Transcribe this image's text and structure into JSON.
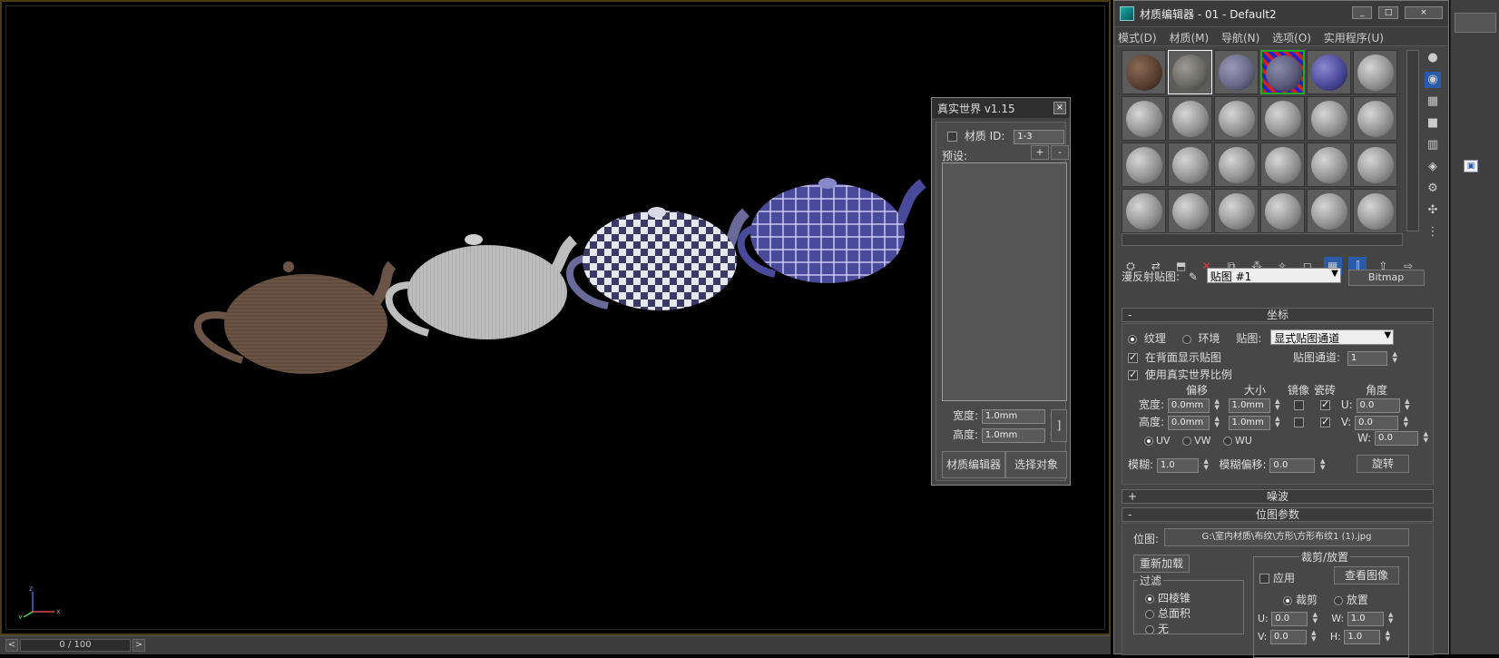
{
  "viewport": {
    "timeline": {
      "frame": "0 / 100",
      "prev": "<",
      "next": ">"
    },
    "axis": {
      "x": "x",
      "y": "y",
      "z": "z"
    }
  },
  "rw_panel": {
    "title": "真实世界 v1.15",
    "close": "×",
    "material_id_label": "材质 ID:",
    "material_id_value": "1-3",
    "preset_label": "预设:",
    "add": "+",
    "remove": "-",
    "width_label": "宽度:",
    "width_value": "1.0mm",
    "height_label": "高度:",
    "height_value": "1.0mm",
    "bracket": "]",
    "btn_editor": "材质编辑器",
    "btn_select": "选择对象"
  },
  "material_editor": {
    "title": "材质编辑器 - 01 - Default2",
    "window_buttons": [
      "_",
      "□",
      "×"
    ],
    "menu": [
      "模式(D)",
      "材质(M)",
      "导航(N)",
      "选项(O)",
      "实用程序(U)"
    ],
    "diffuse_label": "漫反射贴图:",
    "map_name": "贴图 #1",
    "map_type": "Bitmap",
    "coords": {
      "header": "坐标",
      "texture": "纹理",
      "environ": "环境",
      "mapping_label": "贴图:",
      "mapping_value": "显式贴图通道",
      "show_back": "在背面显示贴图",
      "real_world": "使用真实世界比例",
      "channel_label": "贴图通道:",
      "channel_value": "1",
      "col_offset": "偏移",
      "col_size": "大小",
      "col_mirror": "镜像",
      "col_tile": "瓷砖",
      "col_angle": "角度",
      "width_label": "宽度:",
      "height_label": "高度:",
      "offset_w": "0.0mm",
      "offset_h": "0.0mm",
      "size_w": "1.0mm",
      "size_h": "1.0mm",
      "u_label": "U:",
      "v_label": "V:",
      "w_label": "W:",
      "angle_u": "0.0",
      "angle_v": "0.0",
      "angle_w": "0.0",
      "uv": "UV",
      "vw": "VW",
      "wu": "WU",
      "blur_label": "模糊:",
      "blur_value": "1.0",
      "blur_offset_label": "模糊偏移:",
      "blur_offset_value": "0.0",
      "rotate": "旋转"
    },
    "noise": {
      "header": "噪波"
    },
    "bitmap_params": {
      "header": "位图参数",
      "bitmap_label": "位图:",
      "bitmap_path": "G:\\室内材质\\布纹\\方形\\方形布纹1 (1).jpg",
      "reload": "重新加载",
      "crop_group": "裁剪/放置",
      "apply": "应用",
      "view_image": "查看图像",
      "crop": "裁剪",
      "place": "放置",
      "filter_group": "过滤",
      "pyramidal": "四棱锥",
      "summed": "总面积",
      "none": "无",
      "u_label": "U:",
      "v_label": "V:",
      "w_label": "W:",
      "h_label": "H:",
      "u_value": "0.0",
      "v_value": "0.0",
      "w_value": "1.0",
      "h_value": "1.0"
    }
  }
}
